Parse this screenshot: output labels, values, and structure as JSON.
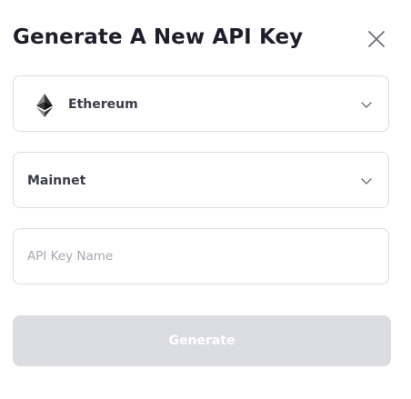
{
  "dialog": {
    "title": "Generate A New API Key",
    "close_icon": "close-icon"
  },
  "network_select": {
    "icon": "ethereum-icon",
    "selected": "Ethereum",
    "chevron_icon": "chevron-down-icon"
  },
  "chain_select": {
    "selected": "Mainnet",
    "chevron_icon": "chevron-down-icon"
  },
  "api_key_name": {
    "value": "",
    "placeholder": "API Key Name"
  },
  "generate_button": {
    "label": "Generate",
    "disabled": true
  },
  "colors": {
    "title": "#1f1f2b",
    "border": "#dcdde2",
    "placeholder": "#a7a9b2",
    "button_disabled_bg": "#dcdde2",
    "button_text": "#ffffff"
  }
}
